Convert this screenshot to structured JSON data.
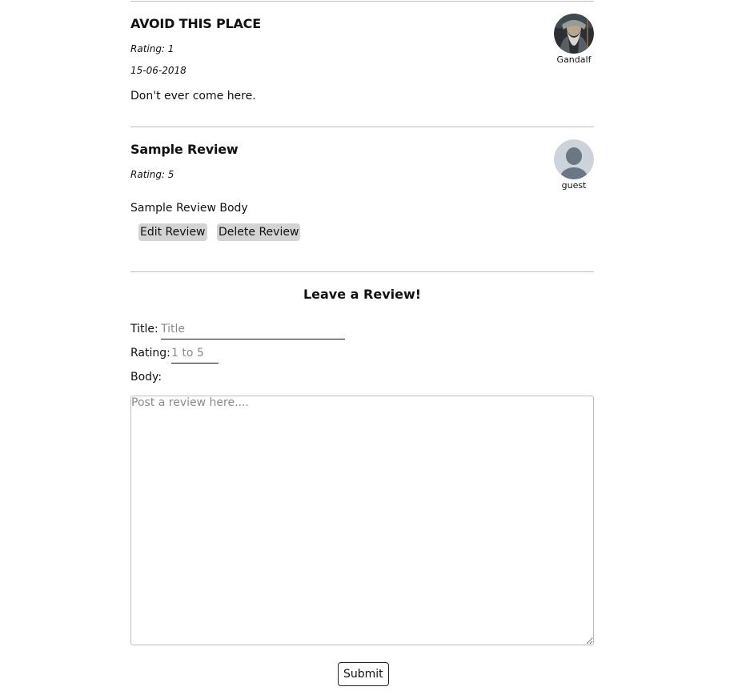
{
  "reviews": [
    {
      "title": "AVOID THIS PLACE",
      "rating": "Rating: 1",
      "date": "15-06-2018",
      "body": "Don't ever come here.",
      "author": "Gandalf",
      "avatar_icon": "gandalf-avatar"
    },
    {
      "title": "Sample Review",
      "rating": "Rating: 5",
      "body": "Sample Review Body",
      "author": "guest",
      "avatar_icon": "default-user-avatar",
      "edit_label": "Edit Review",
      "delete_label": "Delete Review"
    }
  ],
  "form": {
    "heading": "Leave a Review!",
    "title_label": "Title:",
    "title_placeholder": "Title",
    "rating_label": "Rating:",
    "rating_placeholder": "1 to 5",
    "body_label": "Body:",
    "body_placeholder": "Post a review here....",
    "submit_label": "Submit"
  },
  "colors": {
    "button_gray": "#d3d3d3",
    "divider": "#bdbdbd",
    "placeholder": "#8a8a8a"
  }
}
